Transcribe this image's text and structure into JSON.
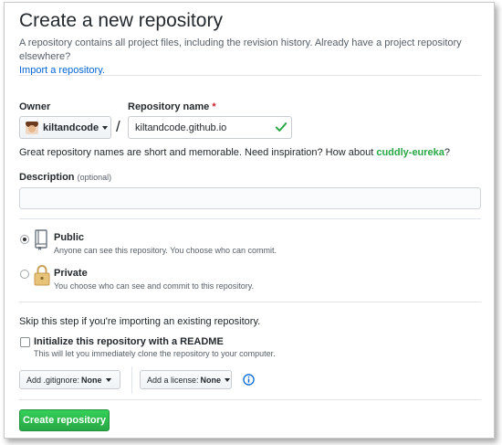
{
  "header": {
    "title": "Create a new repository",
    "subtitle": "A repository contains all project files, including the revision history. Already have a project repository elsewhere?",
    "import_link": "Import a repository."
  },
  "owner": {
    "label": "Owner",
    "value": "kiltandcode"
  },
  "repository_name": {
    "label": "Repository name",
    "required_mark": "*",
    "value": "kiltandcode.github.io",
    "separator": "/"
  },
  "name_hint": {
    "text": "Great repository names are short and memorable. Need inspiration? How about",
    "suggestion": "cuddly-eureka",
    "end": "?"
  },
  "description": {
    "label": "Description",
    "optional": "(optional)",
    "value": ""
  },
  "visibility": {
    "selected": "public",
    "options": [
      {
        "id": "public",
        "title": "Public",
        "note": "Anyone can see this repository. You choose who can commit."
      },
      {
        "id": "private",
        "title": "Private",
        "note": "You choose who can see and commit to this repository."
      }
    ]
  },
  "init": {
    "skip_text": "Skip this step if you're importing an existing repository.",
    "readme_label": "Initialize this repository with a README",
    "readme_note": "This will let you immediately clone the repository to your computer.",
    "readme_checked": false
  },
  "dropdowns": {
    "gitignore_label": "Add .gitignore:",
    "gitignore_value": "None",
    "license_label": "Add a license:",
    "license_value": "None"
  },
  "actions": {
    "create_label": "Create repository"
  },
  "colors": {
    "accent_link": "#0366d6",
    "success_green": "#28a745",
    "required_red": "#cb2431"
  }
}
